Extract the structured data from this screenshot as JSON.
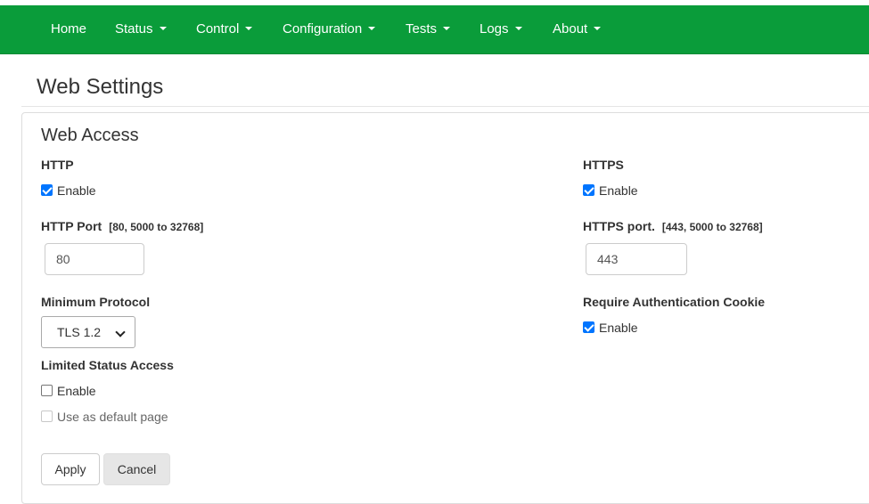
{
  "nav": {
    "items": [
      {
        "label": "Home",
        "dropdown": false
      },
      {
        "label": "Status",
        "dropdown": true
      },
      {
        "label": "Control",
        "dropdown": true
      },
      {
        "label": "Configuration",
        "dropdown": true
      },
      {
        "label": "Tests",
        "dropdown": true
      },
      {
        "label": "Logs",
        "dropdown": true
      },
      {
        "label": "About",
        "dropdown": true
      }
    ]
  },
  "page": {
    "title": "Web Settings",
    "section_title": "Web Access"
  },
  "http": {
    "label": "HTTP",
    "enable_label": "Enable",
    "enabled": true,
    "port_label": "HTTP Port",
    "port_hint": "[80, 5000 to 32768]",
    "port_value": "80"
  },
  "https": {
    "label": "HTTPS",
    "enable_label": "Enable",
    "enabled": true,
    "port_label": "HTTPS port.",
    "port_hint": "[443, 5000 to 32768]",
    "port_value": "443"
  },
  "min_protocol": {
    "label": "Minimum Protocol",
    "selected": "TLS 1.2"
  },
  "auth_cookie": {
    "label": "Require Authentication Cookie",
    "enable_label": "Enable",
    "enabled": true
  },
  "limited_status": {
    "label": "Limited Status Access",
    "enable_label": "Enable",
    "enabled": false,
    "default_page_label": "Use as default page",
    "default_page_checked": false,
    "default_page_disabled": true
  },
  "buttons": {
    "apply": "Apply",
    "cancel": "Cancel"
  },
  "colors": {
    "navbar": "#0a9c3a",
    "checkbox_accent": "#0075ff"
  }
}
